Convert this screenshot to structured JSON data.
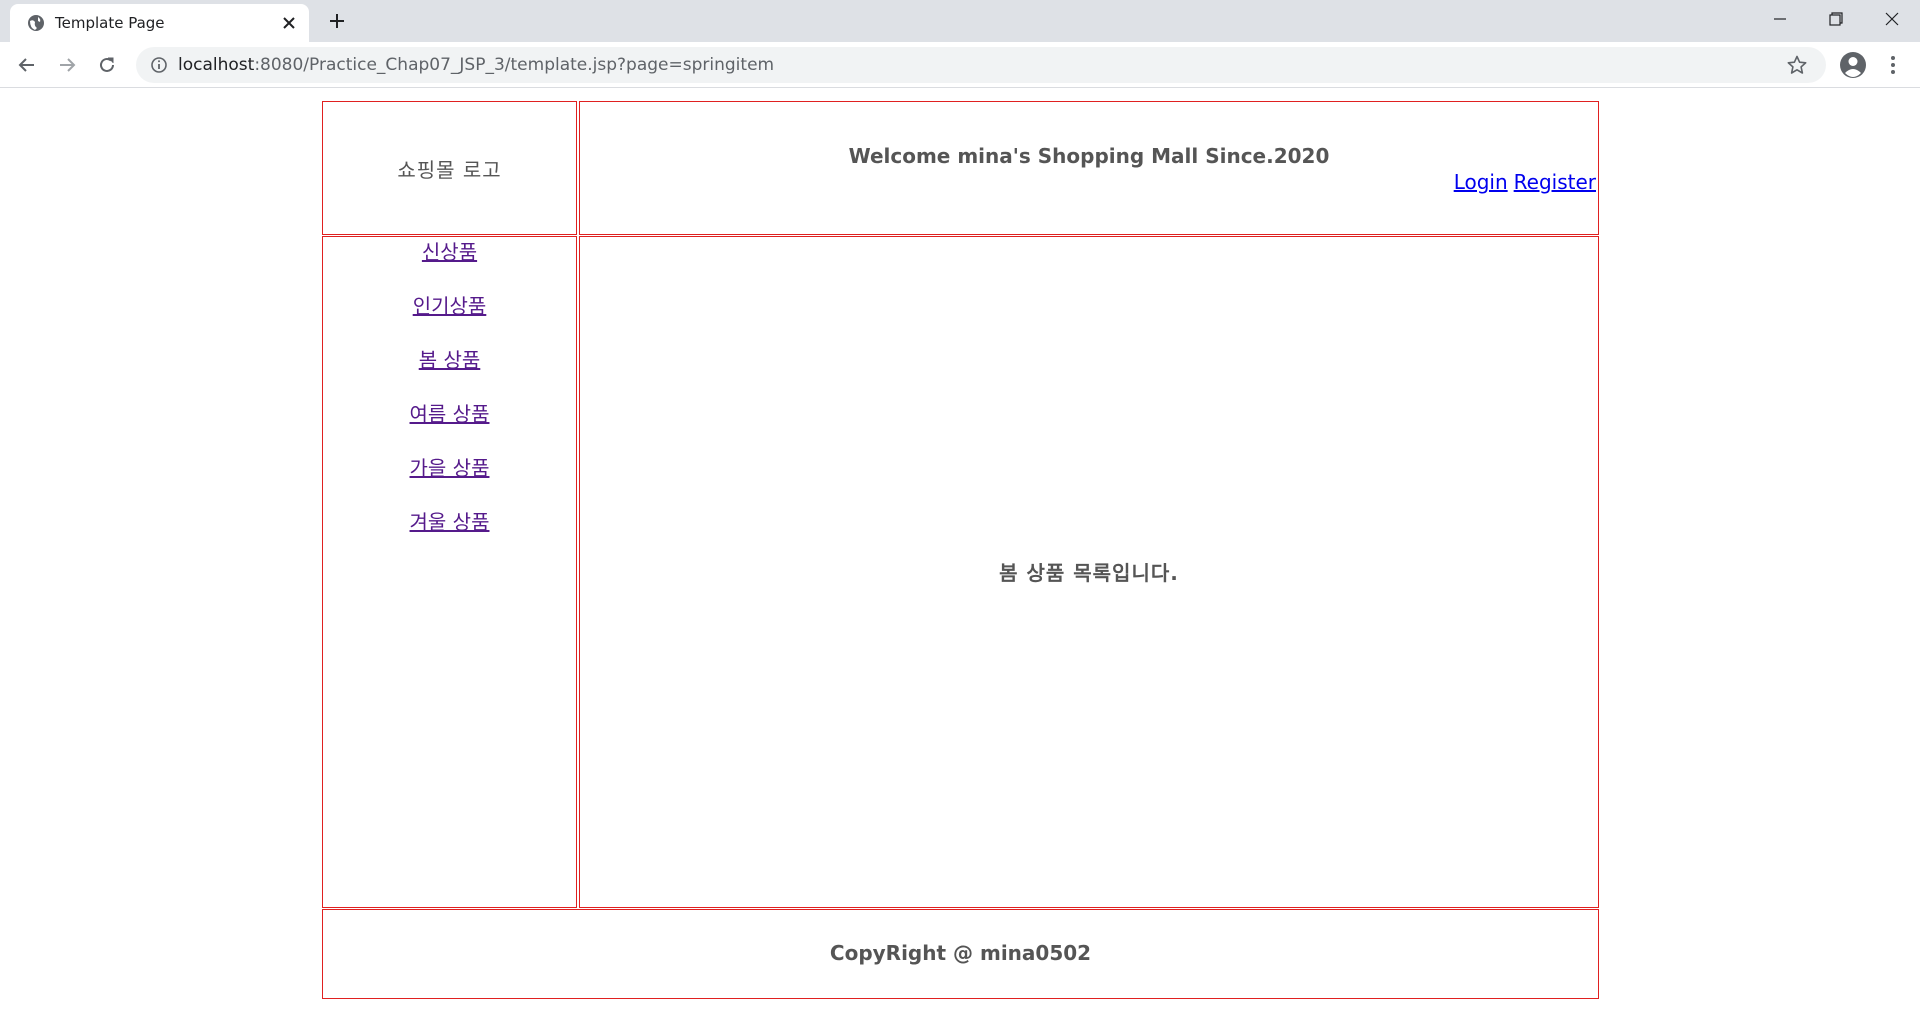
{
  "browser": {
    "tab_title": "Template Page",
    "url_host": "localhost",
    "url_rest": ":8080/Practice_Chap07_JSP_3/template.jsp?page=springitem"
  },
  "page": {
    "logo_text": "쇼핑몰 로고",
    "welcome_text": "Welcome mina's Shopping Mall Since.2020",
    "login_label": "Login",
    "register_label": "Register",
    "menu_items": [
      {
        "label": "신상품"
      },
      {
        "label": "인기상품"
      },
      {
        "label": "봄 상품"
      },
      {
        "label": "여름 상품"
      },
      {
        "label": "가을 상품"
      },
      {
        "label": "겨울 상품"
      }
    ],
    "content_text": "봄 상품 목록입니다.",
    "footer_text": "CopyRight @ mina0502"
  },
  "colors": {
    "border": "#e02020",
    "visited_link": "#551a8b",
    "link": "#0000ee"
  }
}
